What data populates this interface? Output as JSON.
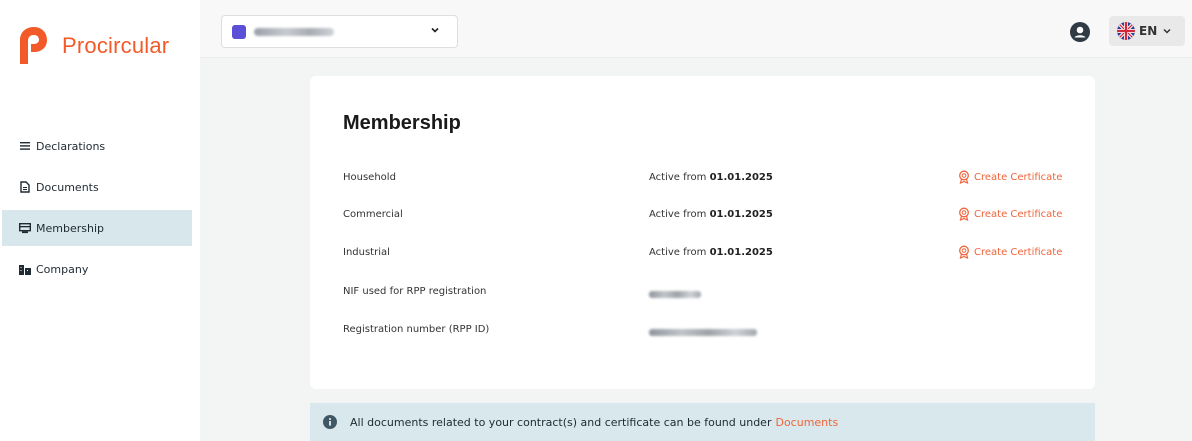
{
  "brand": {
    "name": "Procircular",
    "color": "#f25a2a"
  },
  "sidebar": {
    "items": [
      {
        "label": "Declarations",
        "icon": "list-icon"
      },
      {
        "label": "Documents",
        "icon": "document-icon"
      },
      {
        "label": "Membership",
        "icon": "card-icon",
        "active": true
      },
      {
        "label": "Company",
        "icon": "building-icon"
      }
    ]
  },
  "topbar": {
    "language": "EN"
  },
  "membership": {
    "title": "Membership",
    "rows": [
      {
        "label": "Household",
        "value_prefix": "Active from",
        "value_date": "01.01.2025",
        "action": "Create Certificate"
      },
      {
        "label": "Commercial",
        "value_prefix": "Active from",
        "value_date": "01.01.2025",
        "action": "Create Certificate"
      },
      {
        "label": "Industrial",
        "value_prefix": "Active from",
        "value_date": "01.01.2025",
        "action": "Create Certificate"
      }
    ],
    "nif_label": "NIF used for RPP registration",
    "registration_label": "Registration number (RPP ID)"
  },
  "info": {
    "text": "All documents related to your contract(s) and certificate can be found under",
    "link": "Documents"
  },
  "colors": {
    "accent": "#f0643a",
    "active_nav": "#d7e7ec",
    "info_bg": "#d8e8ed"
  }
}
